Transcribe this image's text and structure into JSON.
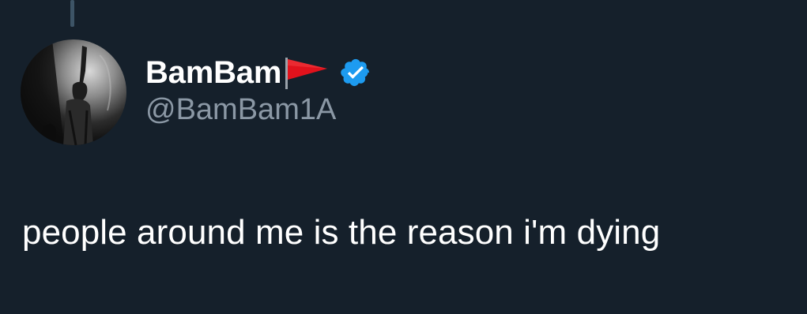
{
  "tweet": {
    "author": {
      "display_name": "BamBam",
      "flag_emoji": "red-triangular-flag",
      "verified": true,
      "handle": "@BamBam1A",
      "avatar": "profile-photo-grayscale-performer"
    },
    "text": "people around me is the reason i'm dying"
  },
  "colors": {
    "background": "#15202b",
    "text_primary": "#ffffff",
    "text_secondary": "#8b98a5",
    "verified_badge": "#1d9bf0",
    "thread_line": "#3d5466",
    "flag": "#e1121c"
  }
}
